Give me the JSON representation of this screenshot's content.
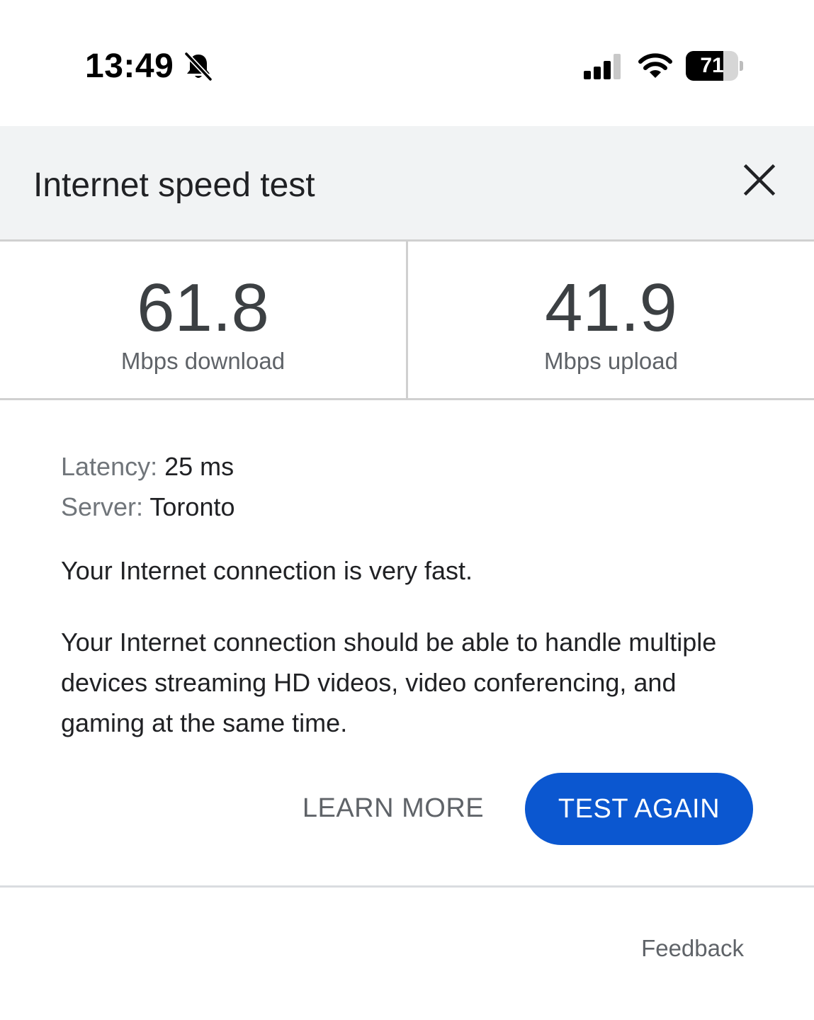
{
  "status_bar": {
    "time": "13:49",
    "battery_level": "71",
    "battery_fraction": 0.71,
    "icons": [
      "bell-slash-icon",
      "cellular-signal-icon",
      "wifi-icon",
      "battery-icon"
    ]
  },
  "header": {
    "title": "Internet speed test",
    "close_icon": "close-icon"
  },
  "results": {
    "download": {
      "value": "61.8",
      "label": "Mbps download"
    },
    "upload": {
      "value": "41.9",
      "label": "Mbps upload"
    }
  },
  "details": {
    "latency_label": "Latency:",
    "latency_value": "25 ms",
    "server_label": "Server:",
    "server_value": "Toronto"
  },
  "summary": "Your Internet connection is very fast.",
  "description": "Your Internet connection should be able to handle multiple devices streaming HD videos, video conferencing, and gaming at the same time.",
  "actions": {
    "learn_more": "LEARN MORE",
    "test_again": "TEST AGAIN"
  },
  "footer": {
    "feedback": "Feedback"
  },
  "colors": {
    "header_bg": "#f1f3f4",
    "primary_button": "#0b57d0",
    "divider": "#d0d0d0",
    "secondary_text": "#5f6368"
  }
}
